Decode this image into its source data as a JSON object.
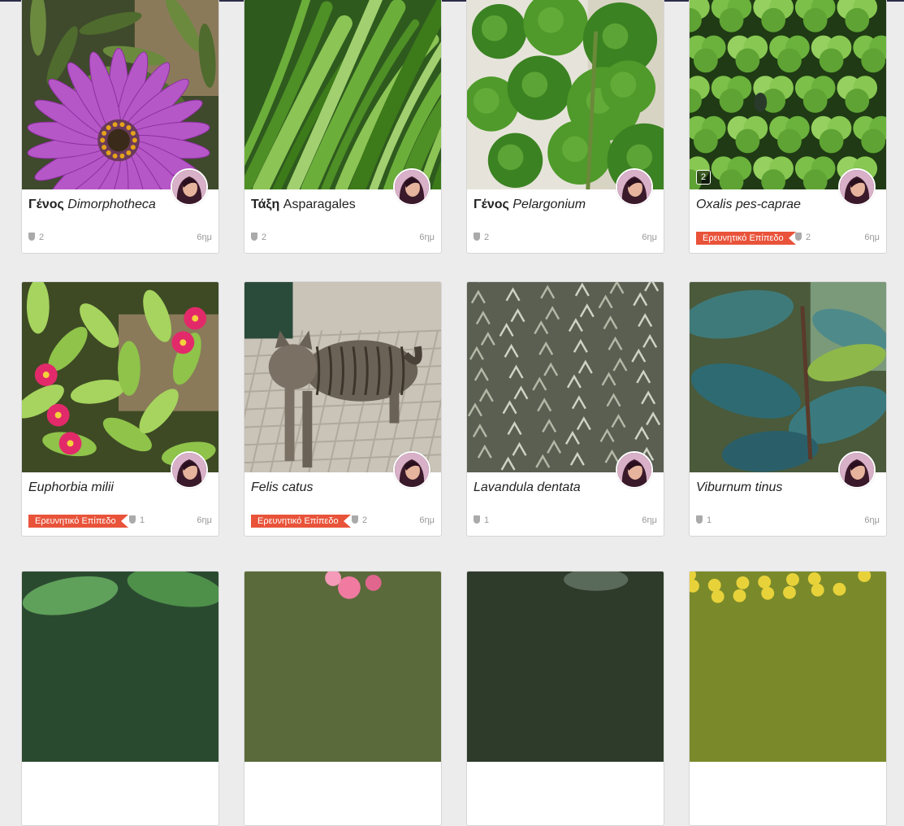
{
  "colors": {
    "badge": "#e8533a",
    "page_bg": "#ececec",
    "topbar": "#2c2c4a"
  },
  "observations": [
    {
      "rank": "Γένος",
      "name": "Dimorphotheca",
      "photo_count": "",
      "badge": "",
      "ids": "2",
      "time": "6ημ",
      "photo_desc": "pink-daisy-photo"
    },
    {
      "rank": "Τάξη",
      "name": "Asparagales",
      "photo_count": "",
      "badge": "",
      "ids": "2",
      "time": "6ημ",
      "photo_desc": "grass-leaves-photo"
    },
    {
      "rank": "Γένος",
      "name": "Pelargonium",
      "photo_count": "",
      "badge": "",
      "ids": "2",
      "time": "6ημ",
      "photo_desc": "geranium-leaves-photo"
    },
    {
      "rank": "",
      "name": "Oxalis pes-caprae",
      "photo_count": "2",
      "badge": "Ερευνητικό Επίπεδο",
      "ids": "2",
      "time": "6ημ",
      "photo_desc": "clover-leaves-photo"
    },
    {
      "rank": "",
      "name": "Euphorbia milii",
      "photo_count": "",
      "badge": "Ερευνητικό Επίπεδο",
      "ids": "1",
      "time": "6ημ",
      "photo_desc": "red-flowers-photo"
    },
    {
      "rank": "",
      "name": "Felis catus",
      "photo_count": "",
      "badge": "Ερευνητικό Επίπεδο",
      "ids": "2",
      "time": "6ημ",
      "photo_desc": "tabby-cat-photo"
    },
    {
      "rank": "",
      "name": "Lavandula dentata",
      "photo_count": "",
      "badge": "",
      "ids": "1",
      "time": "6ημ",
      "photo_desc": "lavender-shrub-photo"
    },
    {
      "rank": "",
      "name": "Viburnum tinus",
      "photo_count": "",
      "badge": "",
      "ids": "1",
      "time": "6ημ",
      "photo_desc": "dark-green-leaves-photo"
    },
    {
      "rank": "",
      "name": "",
      "photo_count": "",
      "badge": "",
      "ids": "",
      "time": "",
      "photo_desc": "succulent-leaves-photo"
    },
    {
      "rank": "",
      "name": "",
      "photo_count": "",
      "badge": "",
      "ids": "",
      "time": "",
      "photo_desc": "pink-begonia-photo"
    },
    {
      "rank": "",
      "name": "",
      "photo_count": "",
      "badge": "",
      "ids": "",
      "time": "",
      "photo_desc": "dark-foliage-photo"
    },
    {
      "rank": "",
      "name": "",
      "photo_count": "",
      "badge": "",
      "ids": "",
      "time": "",
      "photo_desc": "yellow-flowers-photo"
    }
  ]
}
